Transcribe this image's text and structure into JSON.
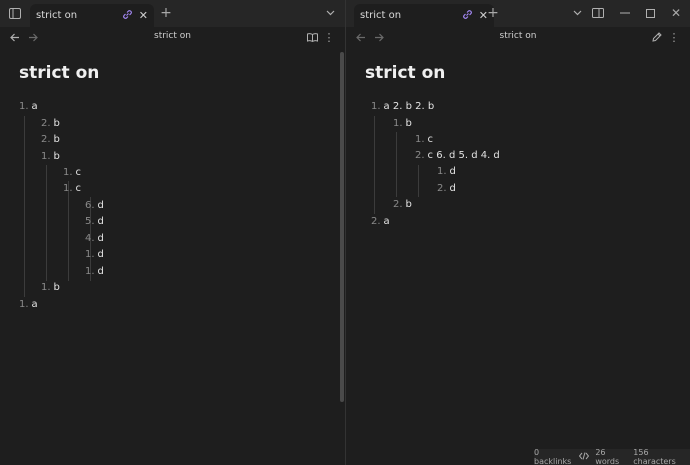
{
  "tabs": {
    "left": {
      "title": "strict on"
    },
    "right": {
      "title": "strict on"
    }
  },
  "nav": {
    "left_title": "strict on",
    "right_title": "strict on"
  },
  "left_note": {
    "title": "strict on",
    "items": [
      {
        "num": "1.",
        "text": "a"
      },
      {
        "num": "2.",
        "text": "b"
      },
      {
        "num": "2.",
        "text": "b"
      },
      {
        "num": "1.",
        "text": "b"
      },
      {
        "num": "1.",
        "text": "c"
      },
      {
        "num": "1.",
        "text": "c"
      },
      {
        "num": "6.",
        "text": "d"
      },
      {
        "num": "5.",
        "text": "d"
      },
      {
        "num": "4.",
        "text": "d"
      },
      {
        "num": "1.",
        "text": "d"
      },
      {
        "num": "1.",
        "text": "d"
      },
      {
        "num": "1.",
        "text": "b"
      },
      {
        "num": "1.",
        "text": "a"
      }
    ]
  },
  "right_note": {
    "title": "strict on",
    "items": [
      {
        "num": "1.",
        "text": "a 2. b 2. b"
      },
      {
        "num": "1.",
        "text": "b"
      },
      {
        "num": "1.",
        "text": "c"
      },
      {
        "num": "2.",
        "text": "c 6. d 5. d 4. d"
      },
      {
        "num": "1.",
        "text": "d"
      },
      {
        "num": "2.",
        "text": "d"
      },
      {
        "num": "2.",
        "text": "b"
      },
      {
        "num": "2.",
        "text": "a"
      }
    ]
  },
  "status": {
    "backlinks": "0 backlinks",
    "words": "26 words",
    "characters": "156 characters"
  },
  "icons": {
    "sidebar_toggle": "sidebar-icon",
    "link": "link-icon",
    "close": "close-icon",
    "new_tab": "plus-icon",
    "tab_list": "chevron-down-icon",
    "back": "arrow-left-icon",
    "forward": "arrow-right-icon",
    "reading_view": "book-icon",
    "more": "more-vertical-icon",
    "edit": "pencil-icon",
    "minimize": "minimize-icon",
    "maximize": "maximize-icon",
    "window_close": "close-icon",
    "split": "split-icon"
  },
  "colors": {
    "accent": "#a78bfa",
    "background": "#1e1e1e"
  }
}
